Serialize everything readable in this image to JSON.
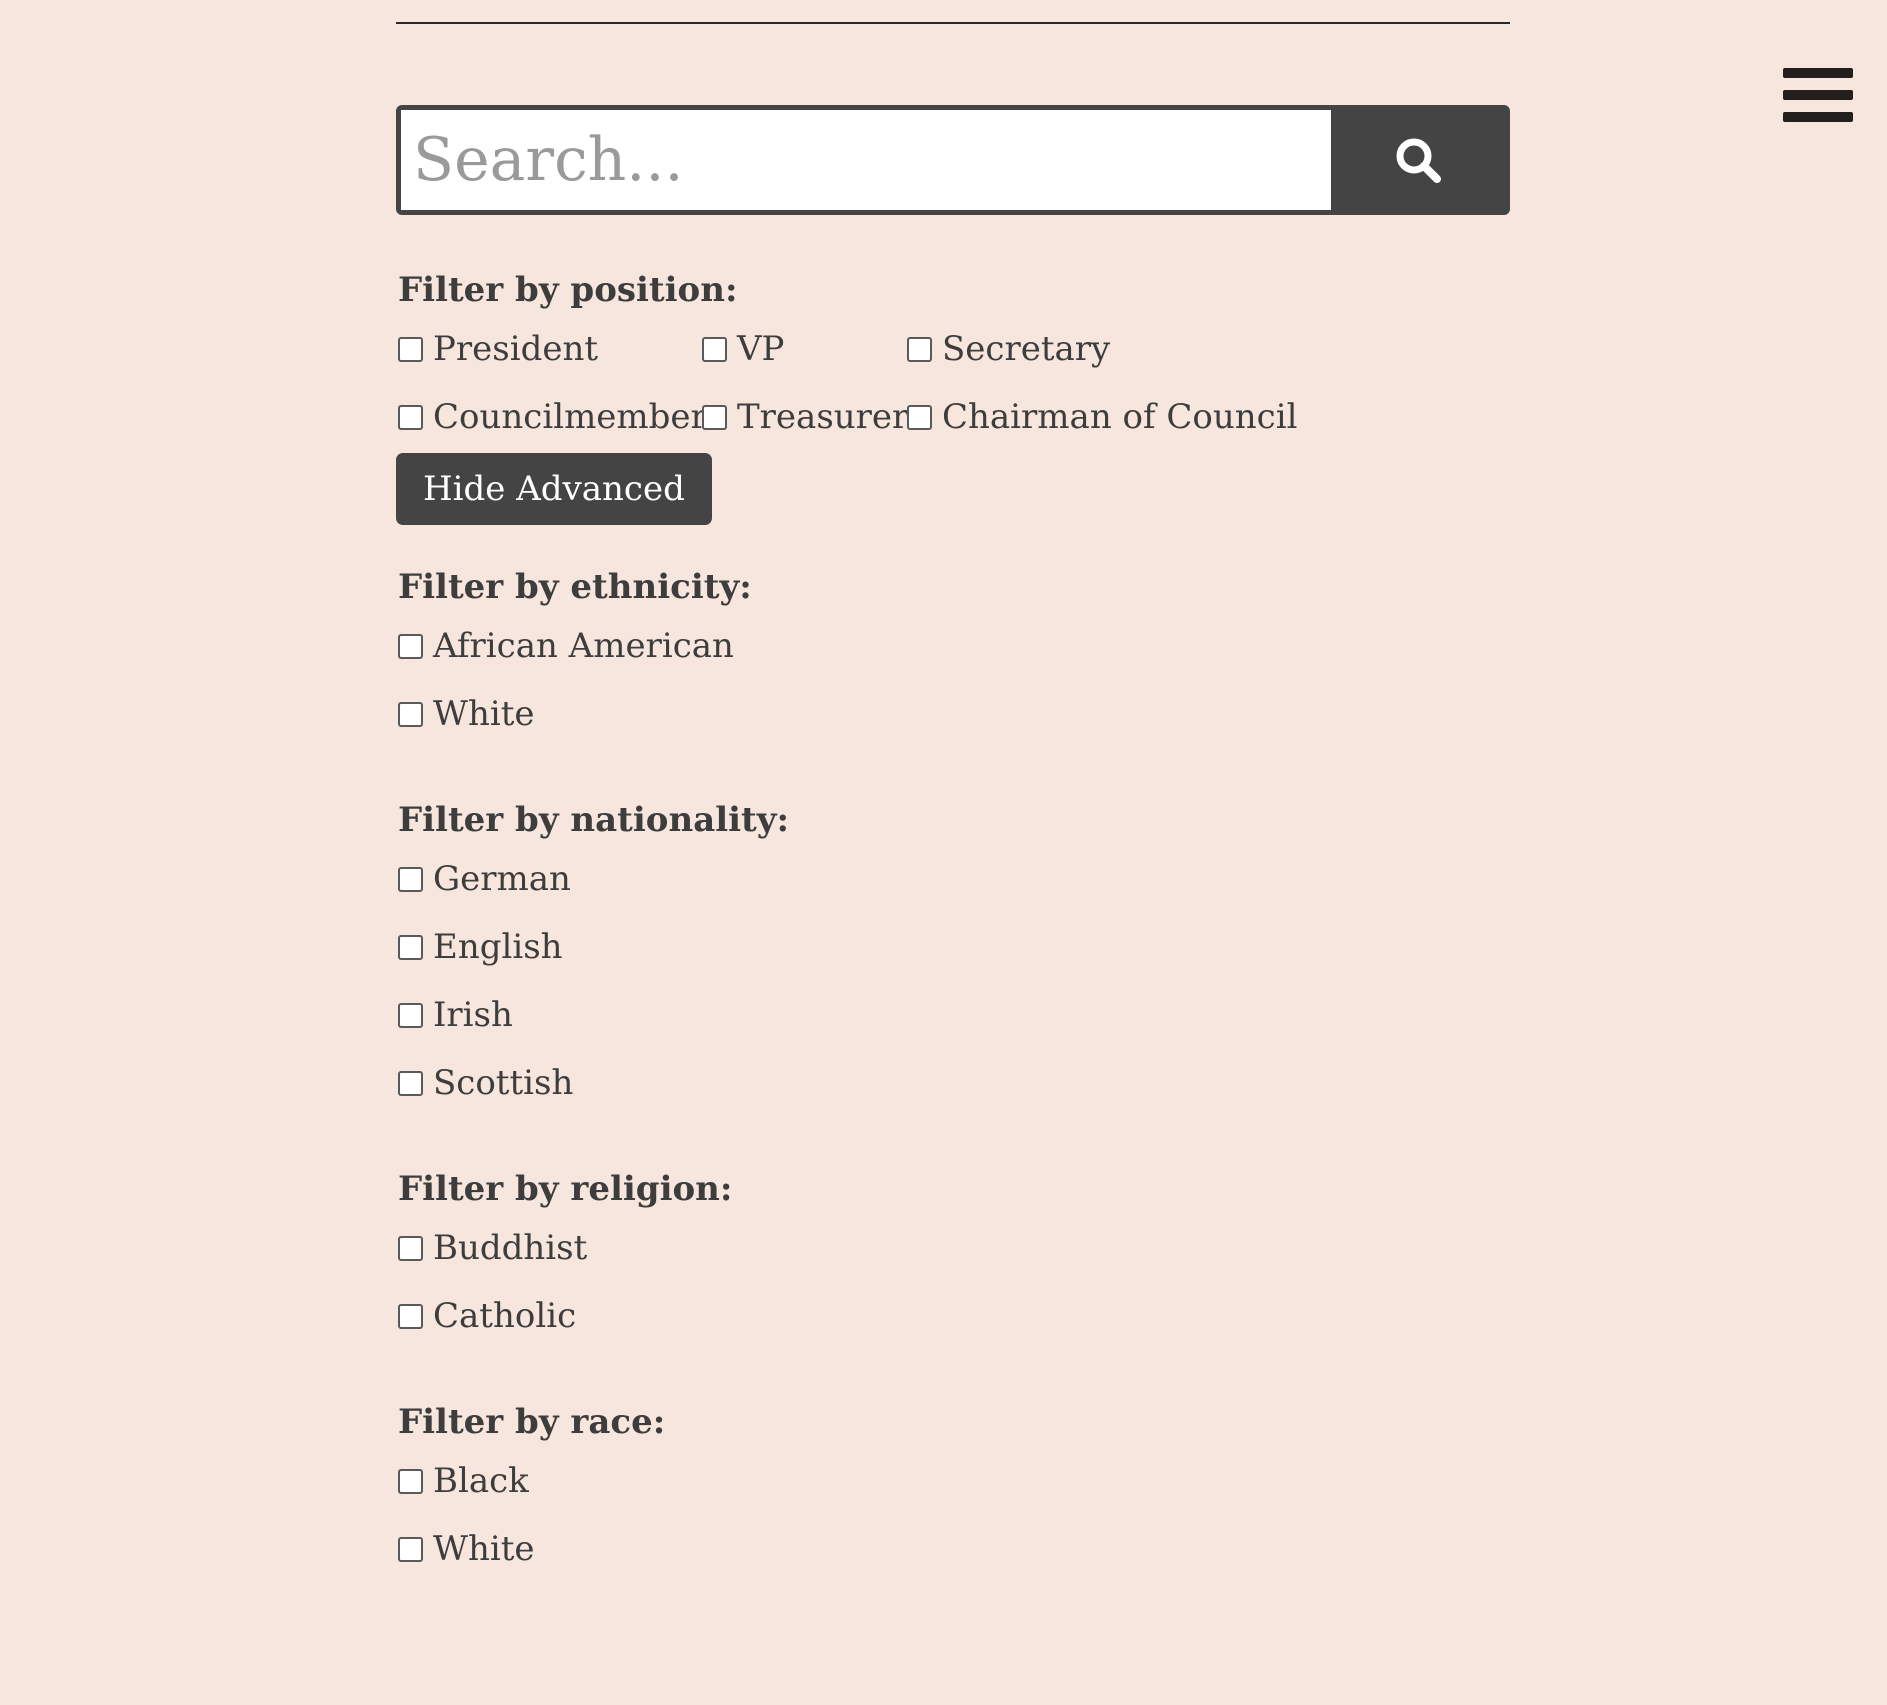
{
  "search": {
    "placeholder": "Search...",
    "button_icon": "search-icon"
  },
  "header": {
    "menu_icon": "hamburger-menu-icon"
  },
  "position_filter": {
    "heading": "Filter by position:",
    "options": [
      "President",
      "VP",
      "Secretary",
      "Councilmember",
      "Treasurer",
      "Chairman of Council"
    ]
  },
  "advanced_toggle_label": "Hide Advanced",
  "ethnicity_filter": {
    "heading": "Filter by ethnicity:",
    "options": [
      "African American",
      "White"
    ]
  },
  "nationality_filter": {
    "heading": "Filter by nationality:",
    "options": [
      "German",
      "English",
      "Irish",
      "Scottish"
    ]
  },
  "religion_filter": {
    "heading": "Filter by religion:",
    "options": [
      "Buddhist",
      "Catholic"
    ]
  },
  "race_filter": {
    "heading": "Filter by race:",
    "options": [
      "Black",
      "White"
    ]
  },
  "colors": {
    "background": "#f7e6dd",
    "button_dark": "#444444",
    "text": "#3d3d3d"
  }
}
